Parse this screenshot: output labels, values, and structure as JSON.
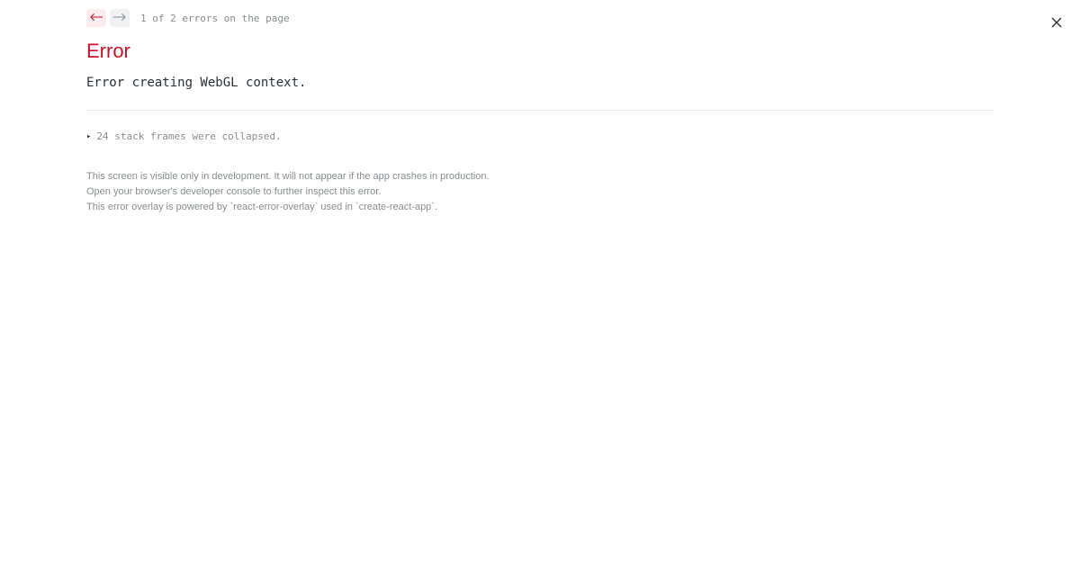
{
  "nav": {
    "error_count_text": "1 of 2 errors on the page"
  },
  "error": {
    "title": "Error",
    "message": "Error creating WebGL context."
  },
  "stack": {
    "collapsed_text": "24 stack frames were collapsed."
  },
  "footer": {
    "line1": "This screen is visible only in development. It will not appear if the app crashes in production.",
    "line2": "Open your browser's developer console to further inspect this error.",
    "line3": "This error overlay is powered by `react-error-overlay` used in `create-react-app`."
  }
}
